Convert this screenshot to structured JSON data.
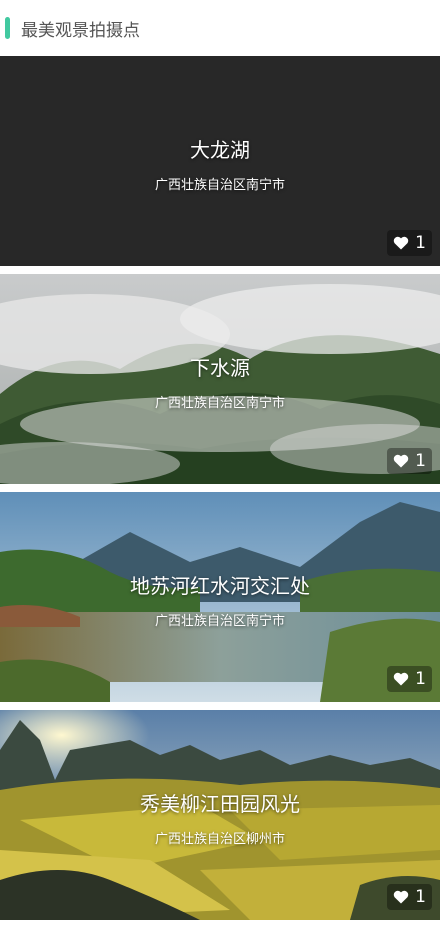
{
  "section": {
    "title": "最美观景拍摄点"
  },
  "spots": [
    {
      "name": "大龙湖",
      "location": "广西壮族自治区南宁市",
      "likes": "1"
    },
    {
      "name": "下水源",
      "location": "广西壮族自治区南宁市",
      "likes": "1"
    },
    {
      "name": "地苏河红水河交汇处",
      "location": "广西壮族自治区南宁市",
      "likes": "1"
    },
    {
      "name": "秀美柳江田园风光",
      "location": "广西壮族自治区柳州市",
      "likes": "1"
    }
  ],
  "colors": {
    "accent": "#41c9a0"
  },
  "icons": {
    "like": "heart-icon"
  }
}
